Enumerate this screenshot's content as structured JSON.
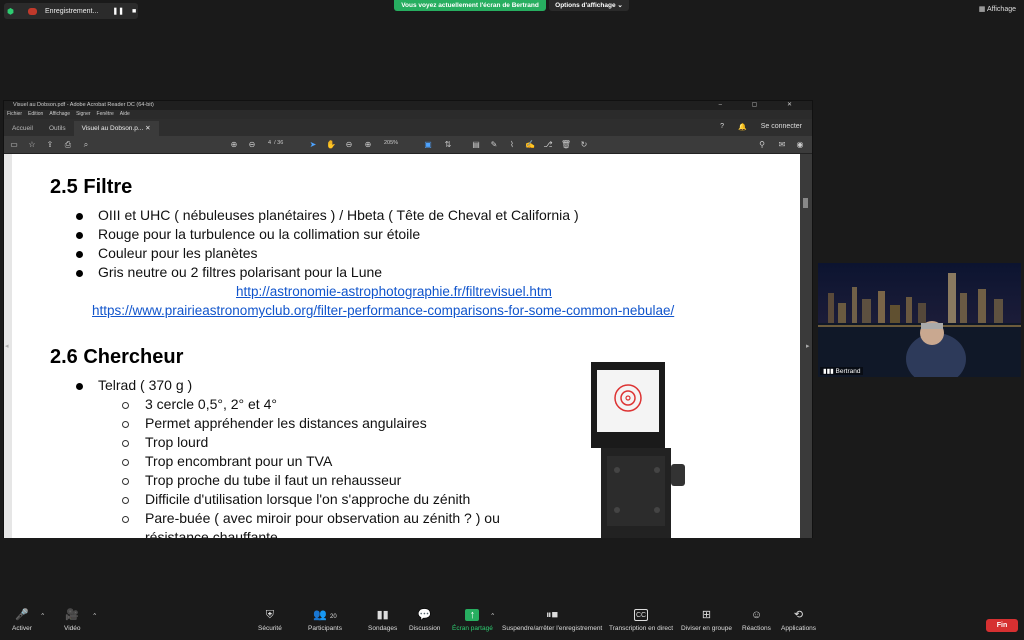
{
  "zoom_top": {
    "recording_label": "Enregistrement...",
    "share_banner": "Vous voyez actuellement l'écran de Bertrand",
    "view_options": "Options d'affichage",
    "view_toggle": "Affichage"
  },
  "acrobat": {
    "title": "Visuel au Dobson.pdf - Adobe Acrobat Reader DC (64-bit)",
    "window_controls": "–  ▢  ✕",
    "menu": [
      "Fichier",
      "Edition",
      "Affichage",
      "Signer",
      "Fenêtre",
      "Aide"
    ],
    "tabs": [
      "Accueil",
      "Outils",
      "Visuel au Dobson.p..."
    ],
    "signin": "Se connecter",
    "page_current": "4",
    "page_total": "/ 36",
    "zoom": "205%"
  },
  "document": {
    "s25_title": "2.5 Filtre",
    "s25_items": [
      "OIII  et UHC ( nébuleuses planétaires ) / Hbeta ( Tête de Cheval et California )",
      "Rouge pour la turbulence ou la collimation sur étoile",
      "Couleur pour les planètes",
      "Gris neutre ou 2 filtres polarisant pour la Lune"
    ],
    "link1": "http://astronomie-astrophotographie.fr/filtrevisuel.htm",
    "link2": "https://www.prairieastronomyclub.org/filter-performance-comparisons-for-some-common-nebulae/",
    "s26_title": "2.6 Chercheur",
    "s26_item": "Telrad ( 370 g )",
    "s26_subitems": [
      "3 cercle 0,5°, 2° et 4°",
      "Permet appréhender les distances angulaires",
      "Trop lourd",
      "Trop encombrant pour un TVA",
      "Trop proche du tube il faut un rehausseur",
      "Difficile d'utilisation lorsque l'on s'approche du zénith",
      "Pare-buée ( avec miroir pour observation au zénith ? ) ou",
      "résistance chauffante"
    ]
  },
  "video": {
    "participant": "Bertrand"
  },
  "bottom_bar": {
    "mute": "Activer",
    "video": "Vidéo",
    "security": "Sécurité",
    "participants": "Participants",
    "participants_count": "20",
    "polls": "Sondages",
    "chat": "Discussion",
    "share": "Écran partagé",
    "record": "Suspendre/arrêter l'enregistrement",
    "transcription": "Transcription en direct",
    "breakout": "Diviser en groupe",
    "reactions": "Réactions",
    "apps": "Applications",
    "end": "Fin"
  },
  "colors": {
    "share_green": "#27ae60",
    "end_red": "#d63031",
    "link_blue": "#1155cc"
  }
}
